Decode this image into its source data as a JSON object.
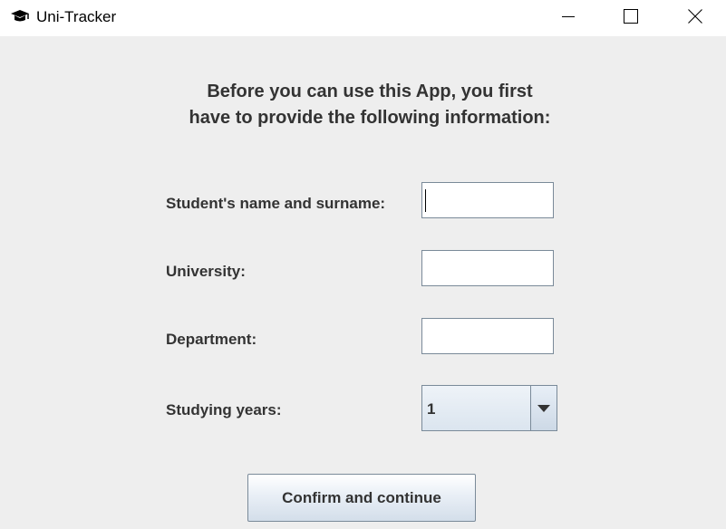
{
  "window": {
    "title": "Uni-Tracker",
    "icon": "graduation-cap-icon",
    "controls": [
      "minimize-icon",
      "maximize-icon",
      "close-icon"
    ]
  },
  "form": {
    "heading_line1": "Before you can use this App, you first",
    "heading_line2": "have to provide the following information:",
    "name_label": "Student's name and surname:",
    "name_value": "",
    "university_label": "University:",
    "university_value": "",
    "department_label": "Department:",
    "department_value": "",
    "years_label": "Studying years:",
    "years_selected": "1",
    "confirm_label": "Confirm and continue"
  },
  "colors": {
    "background": "#eeeeee",
    "titlebar": "#ffffff",
    "text": "#333333",
    "border": "#7a8a99"
  }
}
